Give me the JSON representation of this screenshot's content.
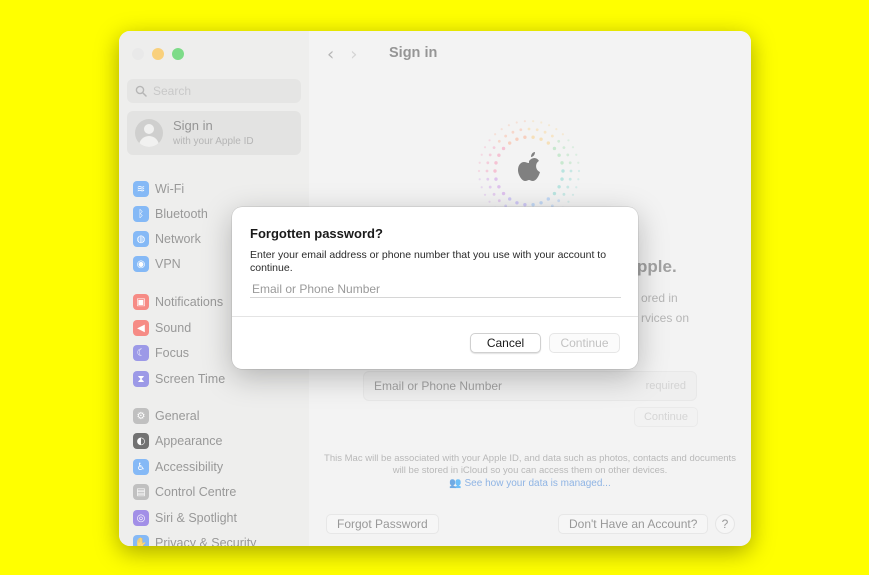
{
  "sidebar": {
    "search_placeholder": "Search",
    "signin": {
      "title": "Sign in",
      "subtitle": "with your Apple ID"
    },
    "items": [
      {
        "label": "Wi-Fi",
        "icon": "wifi-icon",
        "color": "#3a8ff0",
        "glyph": "≋"
      },
      {
        "label": "Bluetooth",
        "icon": "bluetooth-icon",
        "color": "#3a8ff0",
        "glyph": "ᛒ"
      },
      {
        "label": "Network",
        "icon": "globe-icon",
        "color": "#3a8ff0",
        "glyph": "◍"
      },
      {
        "label": "VPN",
        "icon": "vpn-icon",
        "color": "#3a8ff0",
        "glyph": "◉"
      },
      {
        "label": "Notifications",
        "icon": "notifications-icon",
        "color": "#f0443a",
        "glyph": "▣"
      },
      {
        "label": "Sound",
        "icon": "sound-icon",
        "color": "#f0443a",
        "glyph": "◀"
      },
      {
        "label": "Focus",
        "icon": "moon-icon",
        "color": "#5f5bd8",
        "glyph": "☾"
      },
      {
        "label": "Screen Time",
        "icon": "hourglass-icon",
        "color": "#5f5bd8",
        "glyph": "⧗"
      },
      {
        "label": "General",
        "icon": "gear-icon",
        "color": "#9a9a9a",
        "glyph": "⚙"
      },
      {
        "label": "Appearance",
        "icon": "appearance-icon",
        "color": "#1c1c1c",
        "glyph": "◐"
      },
      {
        "label": "Accessibility",
        "icon": "accessibility-icon",
        "color": "#3a8ff0",
        "glyph": "♿"
      },
      {
        "label": "Control Centre",
        "icon": "control-centre-icon",
        "color": "#9a9a9a",
        "glyph": "▤"
      },
      {
        "label": "Siri & Spotlight",
        "icon": "siri-icon",
        "color": "#6a4bd8",
        "glyph": "◎"
      },
      {
        "label": "Privacy & Security",
        "icon": "privacy-hand-icon",
        "color": "#3a8ff0",
        "glyph": "✋"
      }
    ]
  },
  "main": {
    "title": "Sign in",
    "headline_fragment": "pple.",
    "side_lines": [
      "ored in",
      "rvices on"
    ],
    "email_label": "Email or Phone Number",
    "email_required": "required",
    "continue_label": "Continue",
    "footer_text": "This Mac will be associated with your Apple ID, and data such as photos, contacts and documents will be stored in iCloud so you can access them on other devices.",
    "footer_link": "See how your data is managed...",
    "forgot_label": "Forgot Password",
    "no_account_label": "Don't Have an Account?",
    "help_label": "?"
  },
  "dialog": {
    "title": "Forgotten password?",
    "message": "Enter your email address or phone number that you use with your account to continue.",
    "input_placeholder": "Email or Phone Number",
    "input_value": "",
    "cancel_label": "Cancel",
    "continue_label": "Continue"
  },
  "colors": {
    "background": "#ffff00",
    "link": "#4a86d4"
  }
}
